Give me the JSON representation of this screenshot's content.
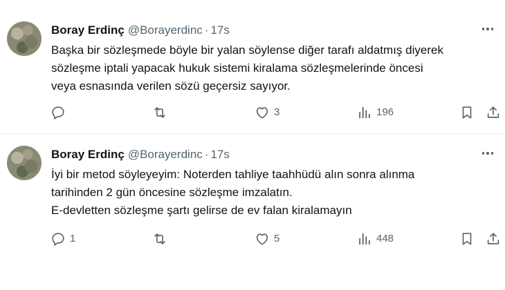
{
  "tweets": [
    {
      "author_name": "Boray Erdinç",
      "handle": "@Borayerdinc",
      "separator": "·",
      "time": "17s",
      "text_lines": [
        "Başka bir sözleşmede böyle bir yalan söylense diğer tarafı aldatmış diyerek",
        "sözleşme iptali yapacak hukuk sistemi kiralama sözleşmelerinde öncesi",
        "veya esnasında verilen sözü geçersiz sayıyor."
      ],
      "replies": "",
      "retweets": "",
      "likes": "3",
      "views": "196"
    },
    {
      "author_name": "Boray Erdinç",
      "handle": "@Borayerdinc",
      "separator": "·",
      "time": "17s",
      "text_lines": [
        "İyi bir metod söyleyeyim: Noterden tahliye taahhüdü alın sonra alınma",
        "tarihinden 2 gün öncesine sözleşme imzalatın.",
        "E-devletten sözleşme şartı gelirse de ev falan kiralamayın"
      ],
      "replies": "1",
      "retweets": "",
      "likes": "5",
      "views": "448"
    }
  ],
  "colors": {
    "text_primary": "#0f1419",
    "text_secondary": "#536471",
    "divider": "#e6ecf0",
    "background": "#ffffff"
  },
  "icons": [
    "more-icon",
    "reply-icon",
    "retweet-icon",
    "like-icon",
    "views-icon",
    "bookmark-icon",
    "share-icon"
  ]
}
